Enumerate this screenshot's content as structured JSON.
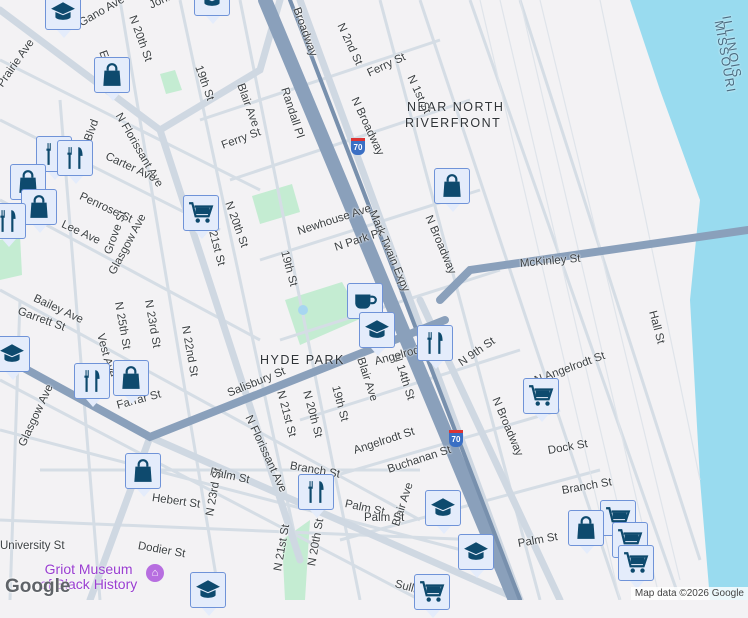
{
  "neighborhoods": {
    "near_north_1": "NEAR NORTH",
    "near_north_2": "RIVERFRONT",
    "hyde_park": "HYDE PARK"
  },
  "states": {
    "illinois": "ILLINOIS",
    "missouri": "MISSOURI"
  },
  "streets": [
    "Gano Ave",
    "N 20th St",
    "Prairie Ave",
    "Blvd",
    "N Florissant Ave",
    "19th St",
    "Blair Ave",
    "Randall Pl",
    "Ferry St",
    "Carter Ave",
    "Penrose St",
    "Lee Ave",
    "Grove St",
    "Glasgow Ave",
    "N 20th St",
    "21st St",
    "Newhouse Ave",
    "N Park Pl",
    "19th St",
    "Bailey Ave",
    "Garrett St",
    "N 25th St",
    "N 23rd St",
    "N 22nd St",
    "Vest Ave",
    "Salisbury St",
    "N 21st St",
    "N 20th St",
    "19th St",
    "Blair Ave",
    "N 14th St",
    "Farrar St",
    "Glasgow Ave",
    "Branch St",
    "Angelrodt St",
    "Buchanan St",
    "Palm St",
    "Palm St",
    "Hebert St",
    "N 23rd St",
    "Dodier St",
    "University St",
    "Palm St",
    "Blair Ave",
    "N 21st St",
    "Broadway",
    "N 2nd St",
    "Ferry St",
    "N 1st St",
    "N Broadway",
    "Mark Twain Expy",
    "N Broadway",
    "McKinley St",
    "N 9th St",
    "N Angelrodt St",
    "Hall St",
    "N Broadway",
    "Dock St",
    "Branch St",
    "Angelrodt St",
    "N Florissant Ave",
    "Sullivan",
    "Palm St",
    "N 20th St",
    "John",
    "Em"
  ],
  "highway": {
    "shield": "70"
  },
  "poi": {
    "name_1": "Griot Museum",
    "name_2": "of Black History"
  },
  "markers": [
    "school",
    "school",
    "shopping",
    "restaurant",
    "restaurant",
    "shopping",
    "shopping",
    "restaurant",
    "grocery",
    "cafe",
    "school",
    "restaurant",
    "shopping",
    "school",
    "restaurant",
    "shopping",
    "grocery",
    "shopping",
    "restaurant",
    "school",
    "school",
    "grocery",
    "grocery",
    "grocery",
    "shopping",
    "school",
    "grocery"
  ],
  "branding": {
    "logo": "Google",
    "attribution": "Map data ©2026 Google"
  },
  "colors": {
    "water": "#99dbef",
    "freeway": "#8aa0bb",
    "park": "#c4ecd2",
    "road": "#d5dde5",
    "marker_icon": "#0e4a6e"
  }
}
